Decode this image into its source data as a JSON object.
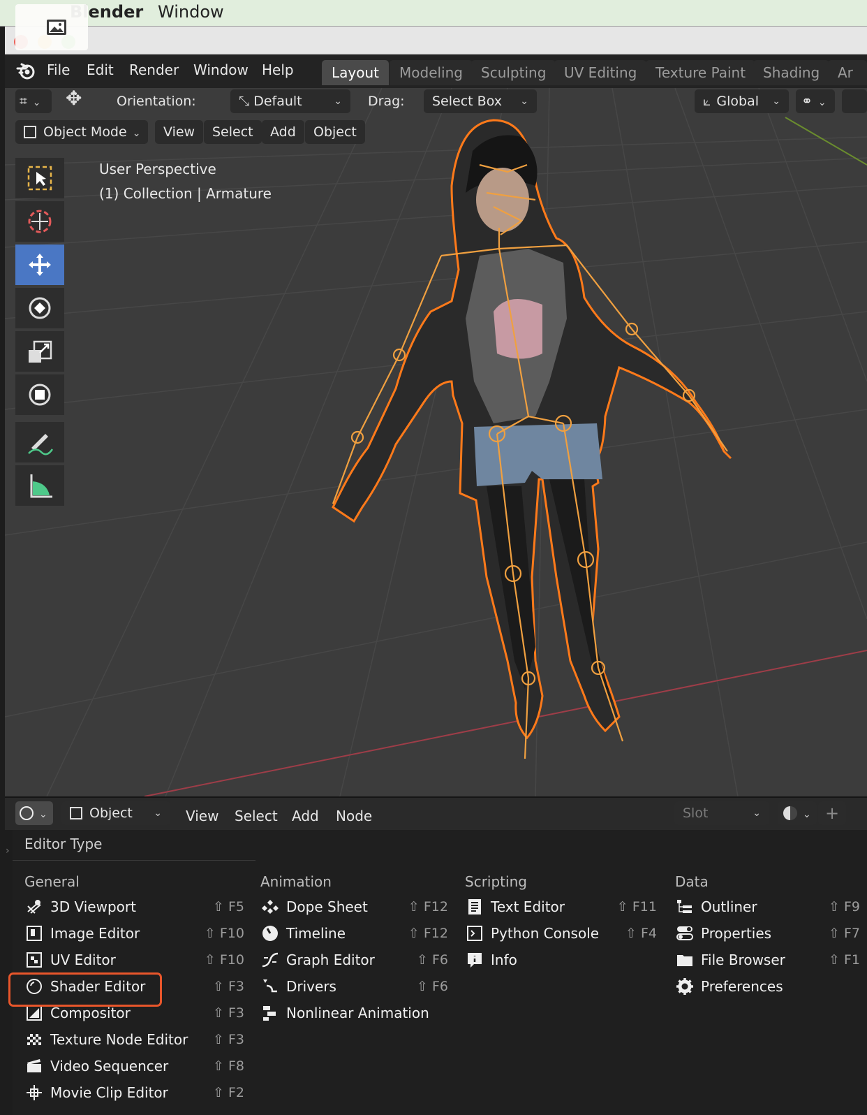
{
  "mac_menubar": {
    "app_name": "Blender",
    "window_menu": "Window"
  },
  "top_menu": [
    "File",
    "Edit",
    "Render",
    "Window",
    "Help"
  ],
  "workspace_tabs": [
    "Layout",
    "Modeling",
    "Sculpting",
    "UV Editing",
    "Texture Paint",
    "Shading",
    "Ar"
  ],
  "active_tab": "Layout",
  "viewport_header": {
    "orientation_label": "Orientation:",
    "orientation_value": "Default",
    "drag_label": "Drag:",
    "drag_value": "Select Box",
    "transform_orientation": "Global"
  },
  "viewport_menu": {
    "mode": "Object Mode",
    "items": [
      "View",
      "Select",
      "Add",
      "Object"
    ]
  },
  "viewport_overlay": {
    "perspective": "User Perspective",
    "collection": "(1) Collection | Armature"
  },
  "tools": [
    "select-box-icon",
    "cursor-icon",
    "move-icon",
    "rotate-icon",
    "scale-icon",
    "transform-icon",
    "annotate-icon",
    "measure-icon"
  ],
  "lower_editor_header": {
    "object_label": "Object",
    "items": [
      "View",
      "Select",
      "Add",
      "Node"
    ],
    "slot": "Slot"
  },
  "editor_type_menu": {
    "title": "Editor Type",
    "columns": [
      {
        "title": "General",
        "items": [
          {
            "label": "3D Viewport",
            "shortcut": "⇧ F5",
            "icon": "viewport-3d-icon"
          },
          {
            "label": "Image Editor",
            "shortcut": "⇧ F10",
            "icon": "image-editor-icon"
          },
          {
            "label": "UV Editor",
            "shortcut": "⇧ F10",
            "icon": "uv-editor-icon"
          },
          {
            "label": "Shader Editor",
            "shortcut": "⇧ F3",
            "icon": "shader-editor-icon"
          },
          {
            "label": "Compositor",
            "shortcut": "⇧ F3",
            "icon": "compositor-icon"
          },
          {
            "label": "Texture Node Editor",
            "shortcut": "⇧ F3",
            "icon": "texture-node-icon"
          },
          {
            "label": "Video Sequencer",
            "shortcut": "⇧ F8",
            "icon": "video-sequencer-icon"
          },
          {
            "label": "Movie Clip Editor",
            "shortcut": "⇧ F2",
            "icon": "movie-clip-icon"
          }
        ]
      },
      {
        "title": "Animation",
        "items": [
          {
            "label": "Dope Sheet",
            "shortcut": "⇧ F12",
            "icon": "dope-sheet-icon"
          },
          {
            "label": "Timeline",
            "shortcut": "⇧ F12",
            "icon": "timeline-icon"
          },
          {
            "label": "Graph Editor",
            "shortcut": "⇧ F6",
            "icon": "graph-editor-icon"
          },
          {
            "label": "Drivers",
            "shortcut": "⇧ F6",
            "icon": "drivers-icon"
          },
          {
            "label": "Nonlinear Animation",
            "shortcut": "",
            "icon": "nla-icon"
          }
        ]
      },
      {
        "title": "Scripting",
        "items": [
          {
            "label": "Text Editor",
            "shortcut": "⇧ F11",
            "icon": "text-editor-icon"
          },
          {
            "label": "Python Console",
            "shortcut": "⇧ F4",
            "icon": "python-console-icon"
          },
          {
            "label": "Info",
            "shortcut": "",
            "icon": "info-icon"
          }
        ]
      },
      {
        "title": "Data",
        "items": [
          {
            "label": "Outliner",
            "shortcut": "⇧ F9",
            "icon": "outliner-icon"
          },
          {
            "label": "Properties",
            "shortcut": "⇧ F7",
            "icon": "properties-icon"
          },
          {
            "label": "File Browser",
            "shortcut": "⇧ F1",
            "icon": "file-browser-icon"
          },
          {
            "label": "Preferences",
            "shortcut": "",
            "icon": "preferences-icon"
          }
        ]
      }
    ],
    "highlighted_item": "Shader Editor"
  },
  "colors": {
    "accent": "#4a77c4",
    "selection": "#ff7a1a",
    "highlight_box": "#e8562b"
  }
}
